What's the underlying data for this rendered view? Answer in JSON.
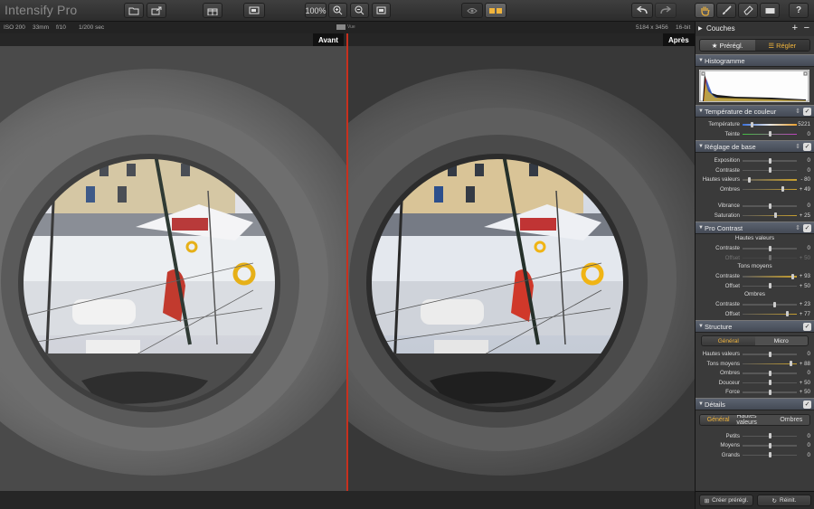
{
  "app": {
    "title": "Intensify Pro"
  },
  "toolbar": {
    "zoom": "100%",
    "help": "?"
  },
  "info": {
    "iso": "ISO 200",
    "focal": "33mm",
    "aperture": "f/10",
    "shutter": "1/200 sec",
    "view_label": "Vue",
    "dimensions": "5184 x 3456",
    "bitdepth": "16-bit"
  },
  "labels": {
    "before": "Avant",
    "after": "Après"
  },
  "panel": {
    "layers_title": "Couches",
    "tab_presets": "Prérégl.",
    "tab_adjust": "Régler",
    "histogram_title": "Histogramme",
    "sections": {
      "color_temp": "Température de couleur",
      "basic": "Réglage de base",
      "pro_contrast": "Pro Contrast",
      "structure": "Structure",
      "details": "Détails"
    },
    "color_temp_rows": [
      {
        "label": "Température",
        "value": "5221",
        "pos": 0.15
      },
      {
        "label": "Teinte",
        "value": "0",
        "pos": 0.5
      }
    ],
    "basic_rows": [
      {
        "label": "Exposition",
        "value": "0",
        "pos": 0.5
      },
      {
        "label": "Contraste",
        "value": "0",
        "pos": 0.5
      },
      {
        "label": "Hautes valeurs",
        "value": "- 80",
        "pos": 0.1
      },
      {
        "label": "Ombres",
        "value": "+ 49",
        "pos": 0.75
      }
    ],
    "basic_rows2": [
      {
        "label": "Vibrance",
        "value": "0",
        "pos": 0.5
      },
      {
        "label": "Saturation",
        "value": "+ 25",
        "pos": 0.62
      }
    ],
    "pc_highlights": "Hautes valeurs",
    "pc_highlight_rows": [
      {
        "label": "Contraste",
        "value": "0",
        "pos": 0.5
      },
      {
        "label": "Offset",
        "value": "+ 50",
        "pos": 0.5,
        "dim": true
      }
    ],
    "pc_midtones": "Tons moyens",
    "pc_mid_rows": [
      {
        "label": "Contraste",
        "value": "+ 93",
        "pos": 0.95
      },
      {
        "label": "Offset",
        "value": "+ 50",
        "pos": 0.5
      }
    ],
    "pc_shadows": "Ombres",
    "pc_shadow_rows": [
      {
        "label": "Contraste",
        "value": "+ 23",
        "pos": 0.6
      },
      {
        "label": "Offset",
        "value": "+ 77",
        "pos": 0.85
      }
    ],
    "structure_tabs": [
      "Général",
      "Micro"
    ],
    "structure_rows": [
      {
        "label": "Hautes valeurs",
        "value": "0",
        "pos": 0.5
      },
      {
        "label": "Tons moyens",
        "value": "+ 88",
        "pos": 0.92
      },
      {
        "label": "Ombres",
        "value": "0",
        "pos": 0.5
      },
      {
        "label": "Douceur",
        "value": "+ 50",
        "pos": 0.5
      },
      {
        "label": "Force",
        "value": "+ 50",
        "pos": 0.5
      }
    ],
    "details_tabs": [
      "Général",
      "Hautes valeurs",
      "Ombres"
    ],
    "details_rows": [
      {
        "label": "Petits",
        "value": "0",
        "pos": 0.5
      },
      {
        "label": "Moyens",
        "value": "0",
        "pos": 0.5
      },
      {
        "label": "Grands",
        "value": "0",
        "pos": 0.5
      }
    ],
    "create_preset": "Créer prérégl.",
    "reset": "Réinit."
  },
  "colors": {
    "accent": "#f0b43c",
    "divider": "#c8301e"
  }
}
